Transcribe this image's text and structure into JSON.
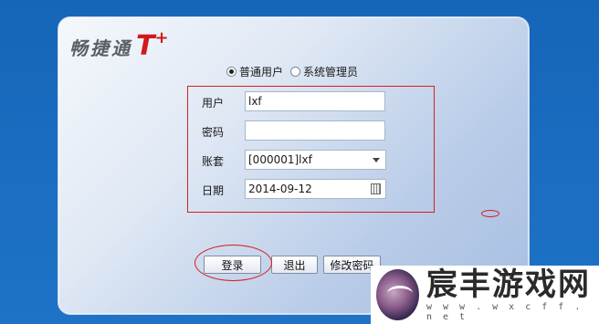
{
  "logo": {
    "text": "畅捷通",
    "mark": "T",
    "plus": "+"
  },
  "login_type": {
    "options": [
      {
        "label": "普通用户",
        "checked": true
      },
      {
        "label": "系统管理员",
        "checked": false
      }
    ]
  },
  "form": {
    "user": {
      "label": "用户",
      "value": "lxf"
    },
    "password": {
      "label": "密码",
      "value": ""
    },
    "account": {
      "label": "账套",
      "value": "[000001]lxf"
    },
    "date": {
      "label": "日期",
      "value": "2014-09-12"
    }
  },
  "buttons": {
    "login": "登录",
    "exit": "退出",
    "change_password": "修改密码"
  },
  "watermark": {
    "title": "宸丰游戏网",
    "url": "w w w . w x c f f . n e t"
  },
  "colors": {
    "background": "#1a6cc0",
    "annotation": "#d81e1e",
    "logo_red": "#d01a1a"
  }
}
